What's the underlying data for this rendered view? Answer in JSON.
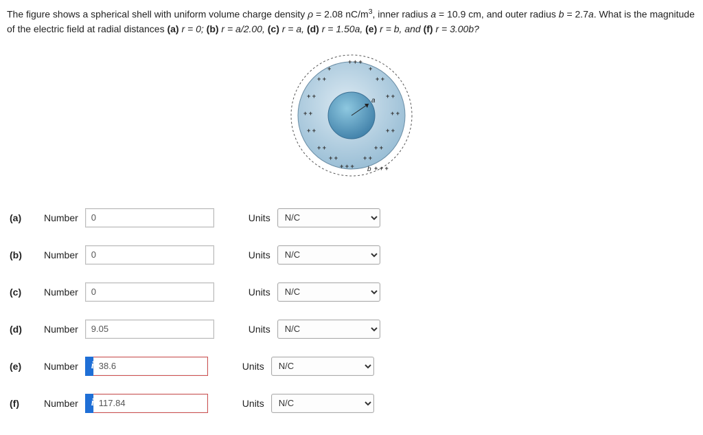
{
  "problem": {
    "intro": "The figure shows a spherical shell with uniform volume charge density ",
    "rho_sym": "ρ",
    "rho_val": " = 2.08 nC/m",
    "rho_exp": "3",
    "inner": ", inner radius ",
    "a_sym": "a",
    "a_val": " = 10.9 cm, and outer radius ",
    "b_sym": "b",
    "b_val": " = 2.7",
    "b_tail": ". What is the magnitude of the electric field at radial distances ",
    "pa_lbl": "(a) ",
    "pa_eq": "r = 0; ",
    "pb_lbl": "(b) ",
    "pb_eq": "r = a/2.00, ",
    "pc_lbl": "(c) ",
    "pc_eq": "r = a, ",
    "pd_lbl": "(d) ",
    "pd_eq": "r = 1.50a, ",
    "pe_lbl": "(e) ",
    "pe_eq": "r = b, and ",
    "pf_lbl": "(f) ",
    "pf_eq": "r = 3.00b?"
  },
  "labels": {
    "number": "Number",
    "units": "Units",
    "info": "i"
  },
  "figure": {
    "inner_label": "a",
    "outer_label": "b"
  },
  "parts": {
    "a": {
      "label": "(a)",
      "value": "0",
      "units": "N/C"
    },
    "b": {
      "label": "(b)",
      "value": "0",
      "units": "N/C"
    },
    "c": {
      "label": "(c)",
      "value": "0",
      "units": "N/C"
    },
    "d": {
      "label": "(d)",
      "value": "9.05",
      "units": "N/C"
    },
    "e": {
      "label": "(e)",
      "value": "38.6",
      "units": "N/C"
    },
    "f": {
      "label": "(f)",
      "value": "117.84",
      "units": "N/C"
    }
  }
}
